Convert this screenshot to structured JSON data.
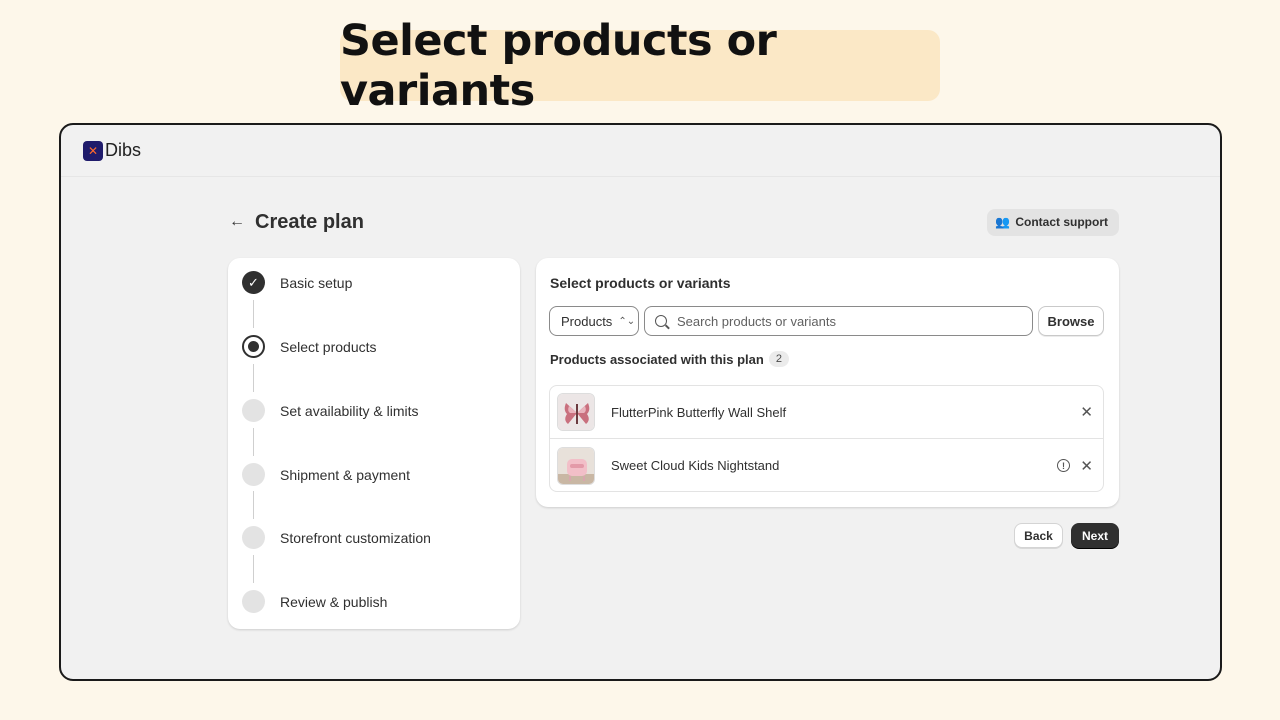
{
  "banner": {
    "title": "Select products or variants"
  },
  "app": {
    "logo_text": "Dibs"
  },
  "header": {
    "back_icon": "arrow-left-icon",
    "title": "Create plan",
    "support_icon": "people-icon",
    "support_label": "Contact support"
  },
  "steps": [
    {
      "label": "Basic setup",
      "state": "done"
    },
    {
      "label": "Select products",
      "state": "current"
    },
    {
      "label": "Set availability & limits",
      "state": "pending"
    },
    {
      "label": "Shipment & payment",
      "state": "pending"
    },
    {
      "label": "Storefront customization",
      "state": "pending"
    },
    {
      "label": "Review & publish",
      "state": "pending"
    }
  ],
  "main": {
    "section_title": "Select products or variants",
    "filter_select": "Products",
    "search_placeholder": "Search products or variants",
    "browse_label": "Browse",
    "associated_label": "Products associated with this plan",
    "associated_count": "2",
    "products": [
      {
        "name": "FlutterPink Butterfly Wall Shelf",
        "has_info": false
      },
      {
        "name": "Sweet Cloud Kids Nightstand",
        "has_info": true
      }
    ]
  },
  "footer": {
    "back_label": "Back",
    "next_label": "Next"
  },
  "colors": {
    "accent": "#303030",
    "banner_bg": "#fbe8c6",
    "page_bg": "#fdf7ea"
  }
}
